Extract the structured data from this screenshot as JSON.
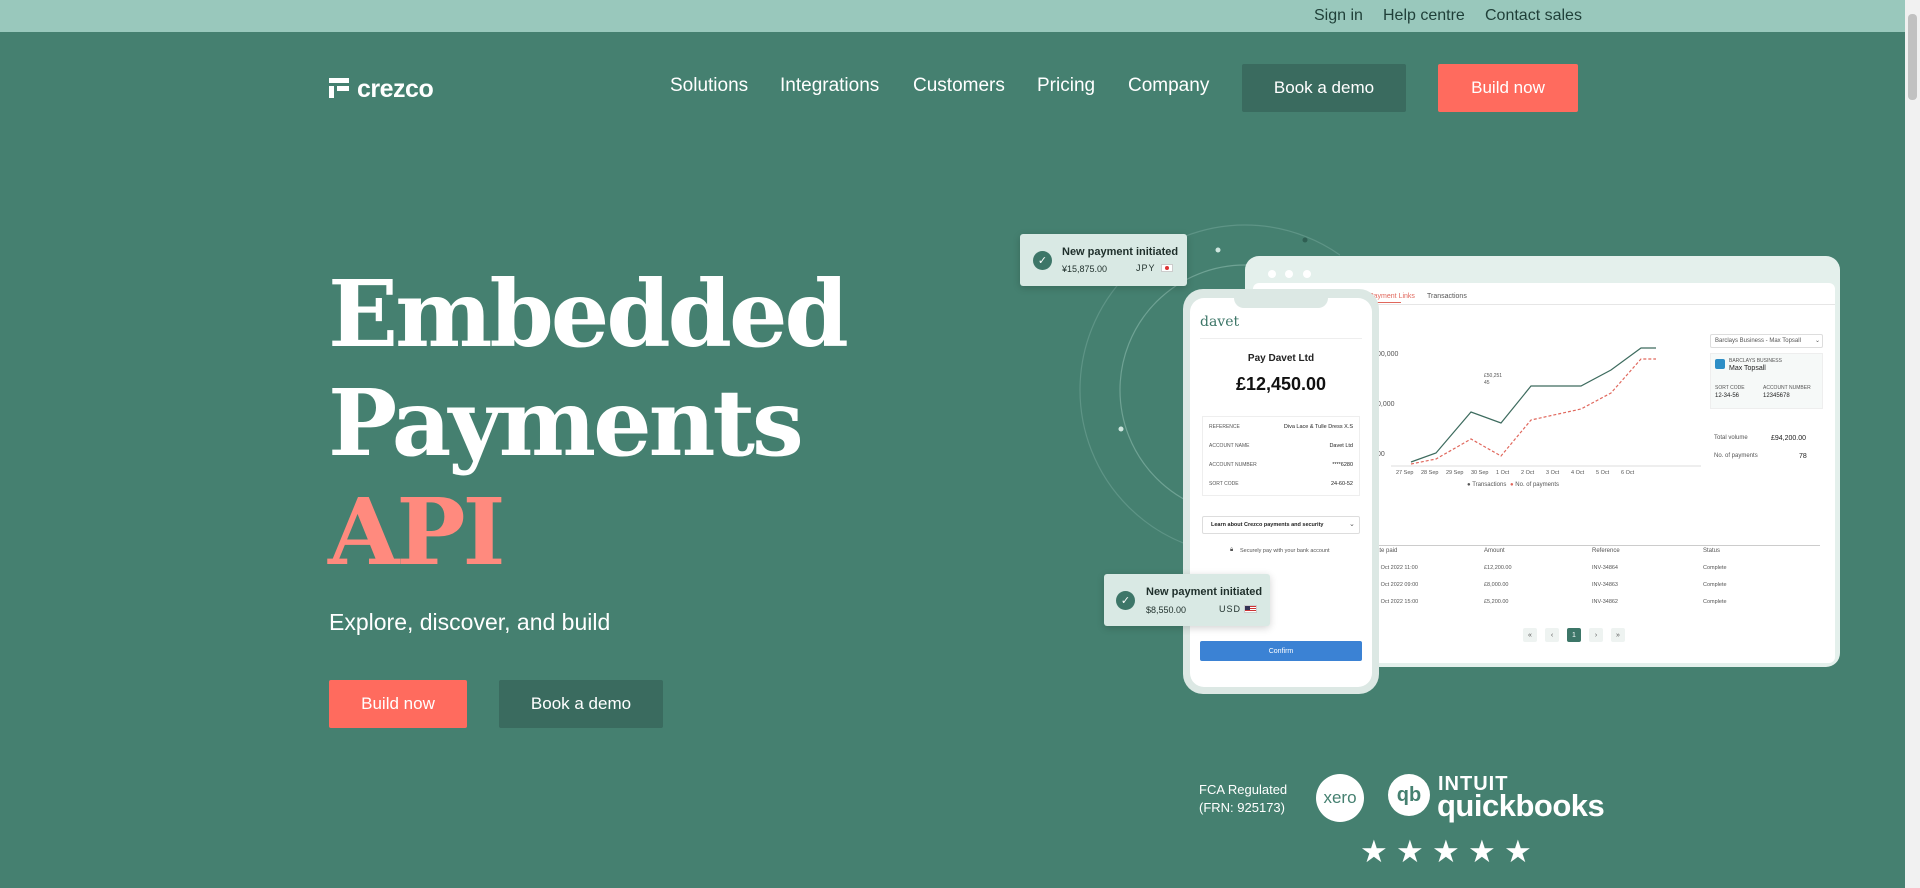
{
  "topbar": {
    "sign_in": "Sign in",
    "help": "Help centre",
    "contact": "Contact sales"
  },
  "brand": {
    "logo_text": "crezco"
  },
  "nav": {
    "items": [
      "Solutions",
      "Integrations",
      "Customers",
      "Pricing",
      "Company"
    ],
    "book_demo": "Book a demo",
    "build_now": "Build now"
  },
  "hero": {
    "line1": "Embedded",
    "line2": "Payments",
    "line3": "API",
    "subtitle": "Explore, discover, and build",
    "build_now": "Build now",
    "book_demo": "Book a demo"
  },
  "toast1": {
    "title": "New payment initiated",
    "amount": "¥15,875.00",
    "currency": "JPY"
  },
  "toast2": {
    "title": "New payment initiated",
    "amount": "$8,550.00",
    "currency": "USD"
  },
  "phone": {
    "brand": "davet",
    "pay_to": "Pay Davet Ltd",
    "amount": "£12,450.00",
    "fields": [
      {
        "label": "REFERENCE",
        "value": "Diva Lace & Tulle Dress X.S"
      },
      {
        "label": "ACCOUNT NAME",
        "value": "Davet Ltd"
      },
      {
        "label": "ACCOUNT NUMBER",
        "value": "****6280"
      },
      {
        "label": "SORT CODE",
        "value": "24-60-52"
      }
    ],
    "learn": "Learn about Crezco payments and security",
    "secure": "Securely pay with your bank account",
    "confirm": "Confirm"
  },
  "dashboard": {
    "tabs": [
      "Payment Links",
      "Transactions"
    ],
    "account_select": "Barclays Business - Max Topsall",
    "bank_label": "BARCLAYS BUSINESS",
    "bank_owner": "Max Topsall",
    "sort_code_label": "SORT CODE",
    "sort_code": "12-34-56",
    "account_number_label": "ACCOUNT NUMBER",
    "account_number": "12345678",
    "total_volume_label": "Total volume",
    "total_volume": "£94,200.00",
    "payments_label": "No. of payments",
    "payments": "78",
    "chart_ticks_y": [
      "00,000",
      "0,000",
      "00"
    ],
    "chart_ticks_x": [
      "27 Sep",
      "28 Sep",
      "29 Sep",
      "30 Sep",
      "1 Oct",
      "2 Oct",
      "3 Oct",
      "4 Oct",
      "5 Oct",
      "6 Oct"
    ],
    "legend": [
      "Transactions",
      "No. of payments"
    ],
    "tooltip": [
      "£50,251",
      "45"
    ],
    "table_headers": [
      "ate paid",
      "Amount",
      "Reference",
      "Status"
    ],
    "table_rows": [
      [
        "6 Oct 2022 11:00",
        "£12,200.00",
        "INV-34864",
        "Complete"
      ],
      [
        "5 Oct 2022 09:00",
        "£8,000.00",
        "INV-34863",
        "Complete"
      ],
      [
        "4 Oct 2022 15:00",
        "£5,200.00",
        "INV-34862",
        "Complete"
      ]
    ],
    "pagination": [
      "«",
      "‹",
      "1",
      "›",
      "»"
    ]
  },
  "trust": {
    "fca_line1": "FCA Regulated",
    "fca_line2": "(FRN: 925173)",
    "xero": "xero",
    "intuit": "INTUIT",
    "quickbooks": "quickbooks",
    "rating_stars": 5
  },
  "colors": {
    "bg": "#458070",
    "topbar": "#99c8bc",
    "coral": "#ff6b5e",
    "dark_button": "#3a6b5f"
  }
}
